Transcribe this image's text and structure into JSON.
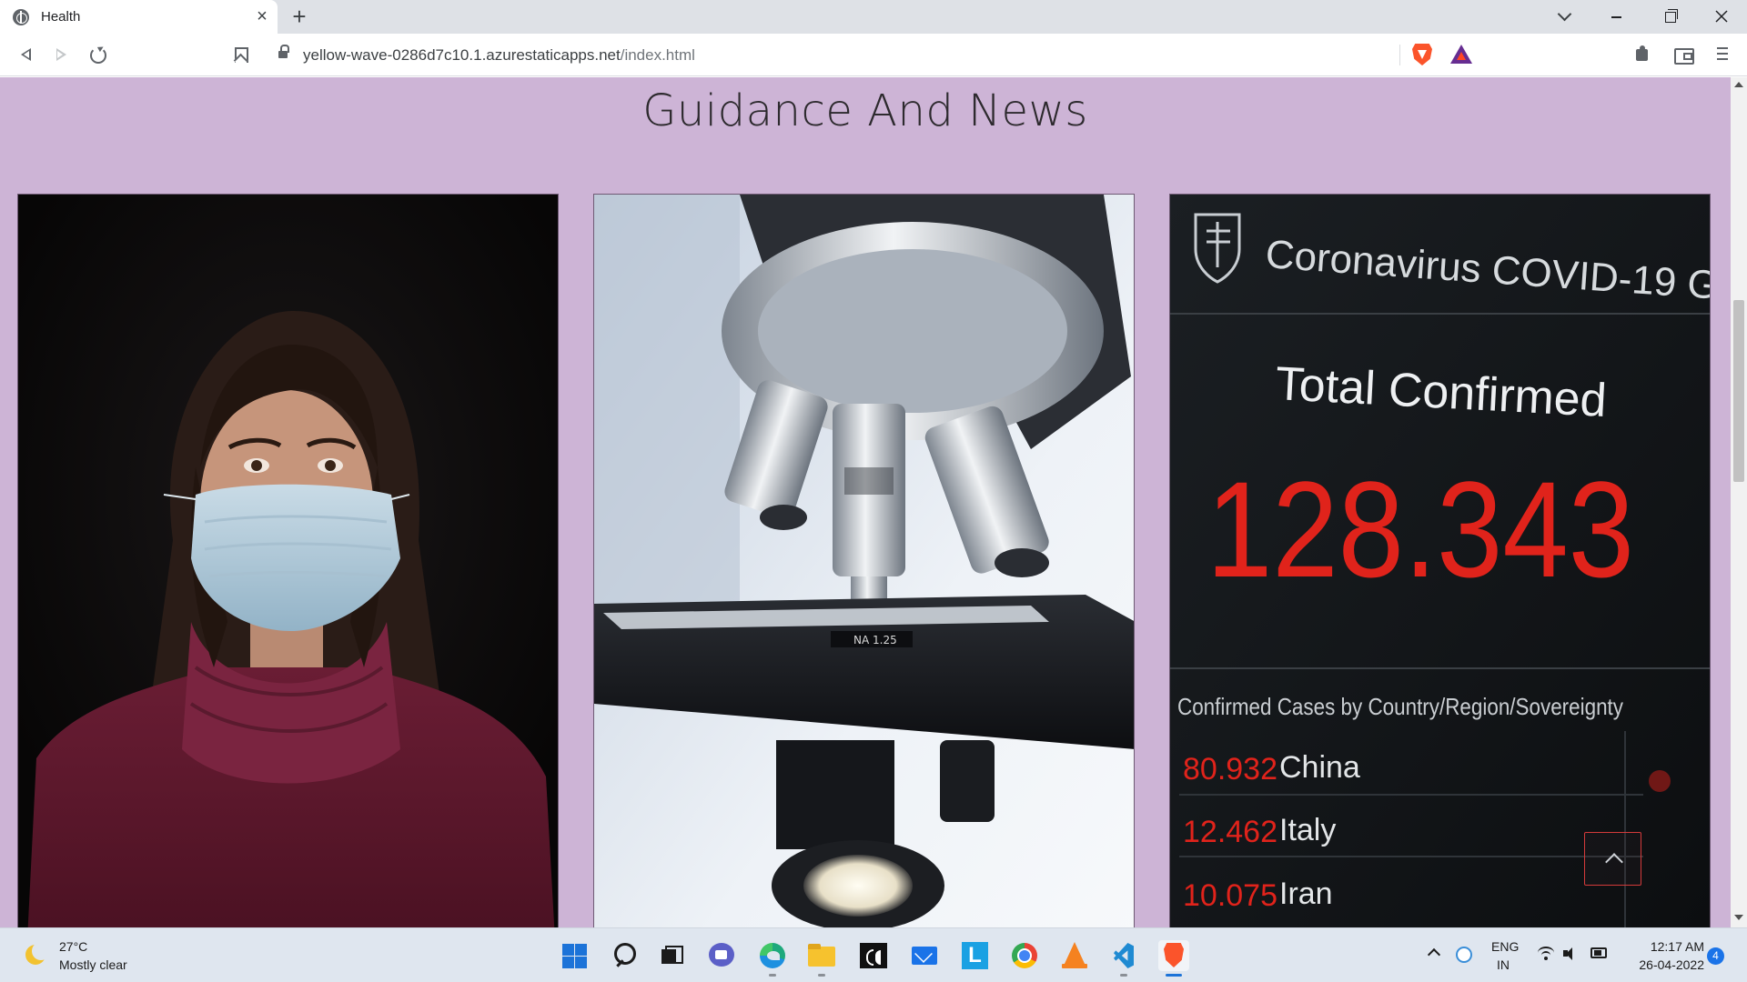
{
  "browser": {
    "tab": {
      "title": "Health",
      "favicon": "globe-icon",
      "close_symbol": "×"
    },
    "new_tab_symbol": "+",
    "url": {
      "host": "yellow-wave-0286d7c10.1.azurestaticapps.net",
      "path": "/index.html"
    }
  },
  "page": {
    "background_color": "#cdb4d6",
    "section_title": "Guidance And News"
  },
  "cards": [
    {
      "image": "woman-wearing-face-mask-photo"
    },
    {
      "image": "laboratory-microscope-photo"
    },
    {
      "image": "covid-19-dashboard-screen-photo"
    }
  ],
  "covid_screen": {
    "header": "Coronavirus COVID-19 Global C",
    "total_label": "Total Confirmed",
    "total_value": "128.343",
    "by_country_label": "Confirmed Cases by Country/Region/Sovereignty",
    "rows": [
      {
        "count": "80.932",
        "country": "China"
      },
      {
        "count": "12.462",
        "country": "Italy"
      },
      {
        "count": "10.075",
        "country": "Iran"
      }
    ],
    "value_color": "#e0231b"
  },
  "microscope_label": "NA 1.25",
  "taskbar": {
    "weather": {
      "temp": "27°C",
      "desc": "Mostly clear"
    },
    "language": {
      "line1": "ENG",
      "line2": "IN"
    },
    "clock": {
      "time": "12:17 AM",
      "date": "26-04-2022"
    },
    "notifications": "4"
  }
}
